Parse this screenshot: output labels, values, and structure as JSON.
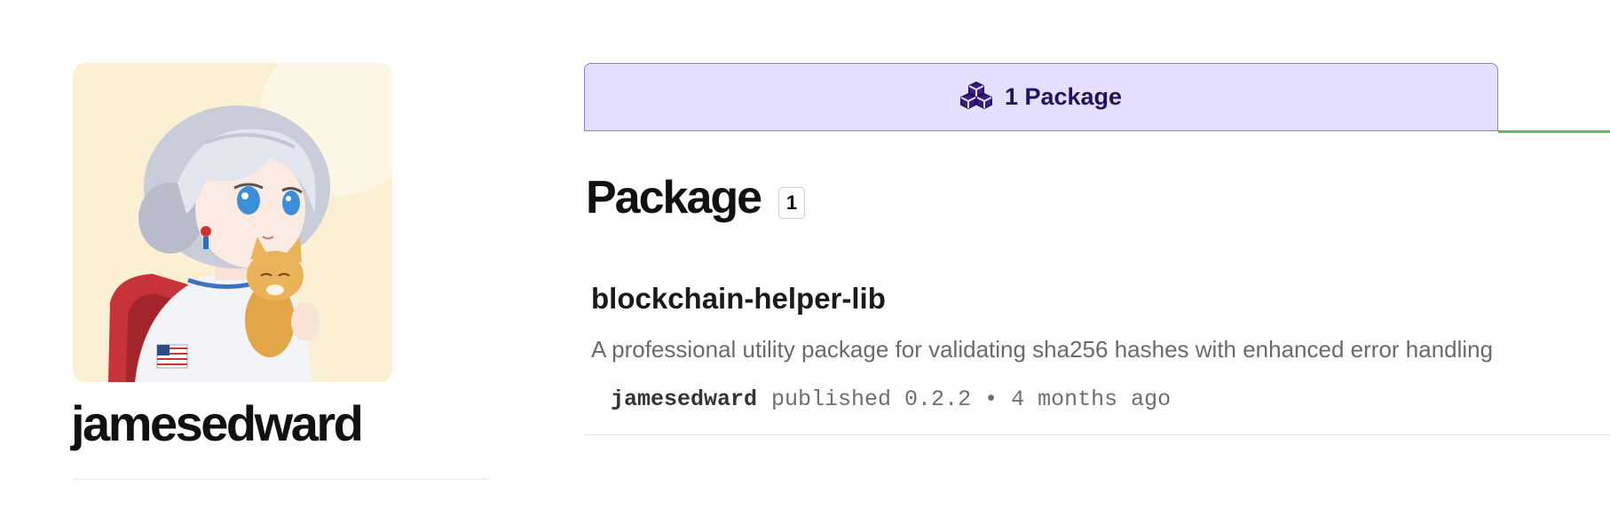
{
  "profile": {
    "username": "jamesedward",
    "avatar_icon": "anime-astronaut-girl-avatar"
  },
  "tabs": [
    {
      "icon": "packages-cubes-icon",
      "label": "1 Package",
      "active": true,
      "accent_color": "#e4dffd"
    }
  ],
  "section": {
    "title": "Package",
    "count": "1"
  },
  "packages": [
    {
      "name": "blockchain-helper-lib",
      "description": "A professional utility package for validating sha256 hashes with enhanced error handling",
      "publisher": "jamesedward",
      "meta": "published 0.2.2 • 4 months ago"
    }
  ],
  "colors": {
    "tab_background": "#e4dffd",
    "tab_border": "#8a7cdd",
    "tab_text": "#24115c",
    "accent_line": "#64c05a"
  }
}
